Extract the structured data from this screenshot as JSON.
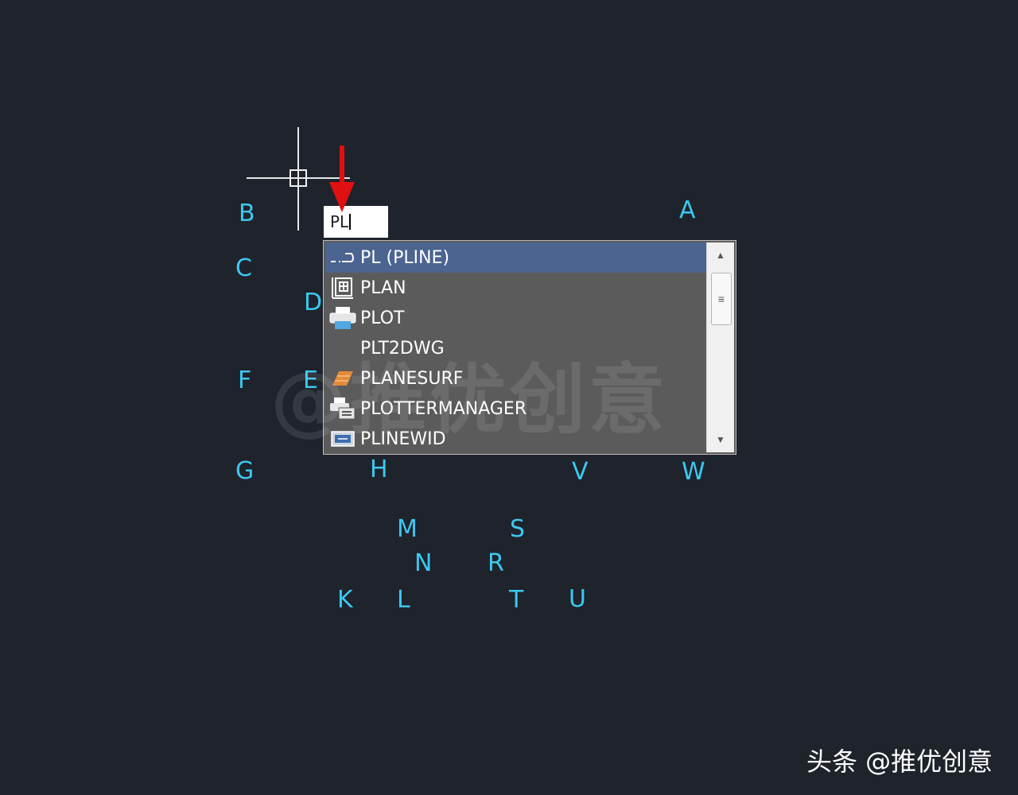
{
  "command_input": {
    "value": "PL"
  },
  "autocomplete": {
    "items": [
      {
        "label": "PL (PLINE)",
        "icon": "polyline-icon",
        "selected": true
      },
      {
        "label": "PLAN",
        "icon": "plan-view-icon",
        "selected": false
      },
      {
        "label": "PLOT",
        "icon": "printer-icon",
        "selected": false
      },
      {
        "label": "PLT2DWG",
        "icon": "",
        "selected": false
      },
      {
        "label": "PLANESURF",
        "icon": "planar-surface-icon",
        "selected": false
      },
      {
        "label": "PLOTTERMANAGER",
        "icon": "plotter-manager-icon",
        "selected": false
      },
      {
        "label": "PLINEWID",
        "icon": "pline-width-icon",
        "selected": false
      }
    ],
    "selected_color": "#4b6490"
  },
  "point_labels": [
    "A",
    "B",
    "C",
    "D",
    "E",
    "F",
    "G",
    "H",
    "K",
    "L",
    "M",
    "N",
    "R",
    "S",
    "T",
    "U",
    "V",
    "W"
  ],
  "watermark": "@推优创意",
  "source_credit": "头条 @推优创意",
  "colors": {
    "background": "#1e232c",
    "label": "#3cc8f0",
    "arrow": "#e01010"
  }
}
